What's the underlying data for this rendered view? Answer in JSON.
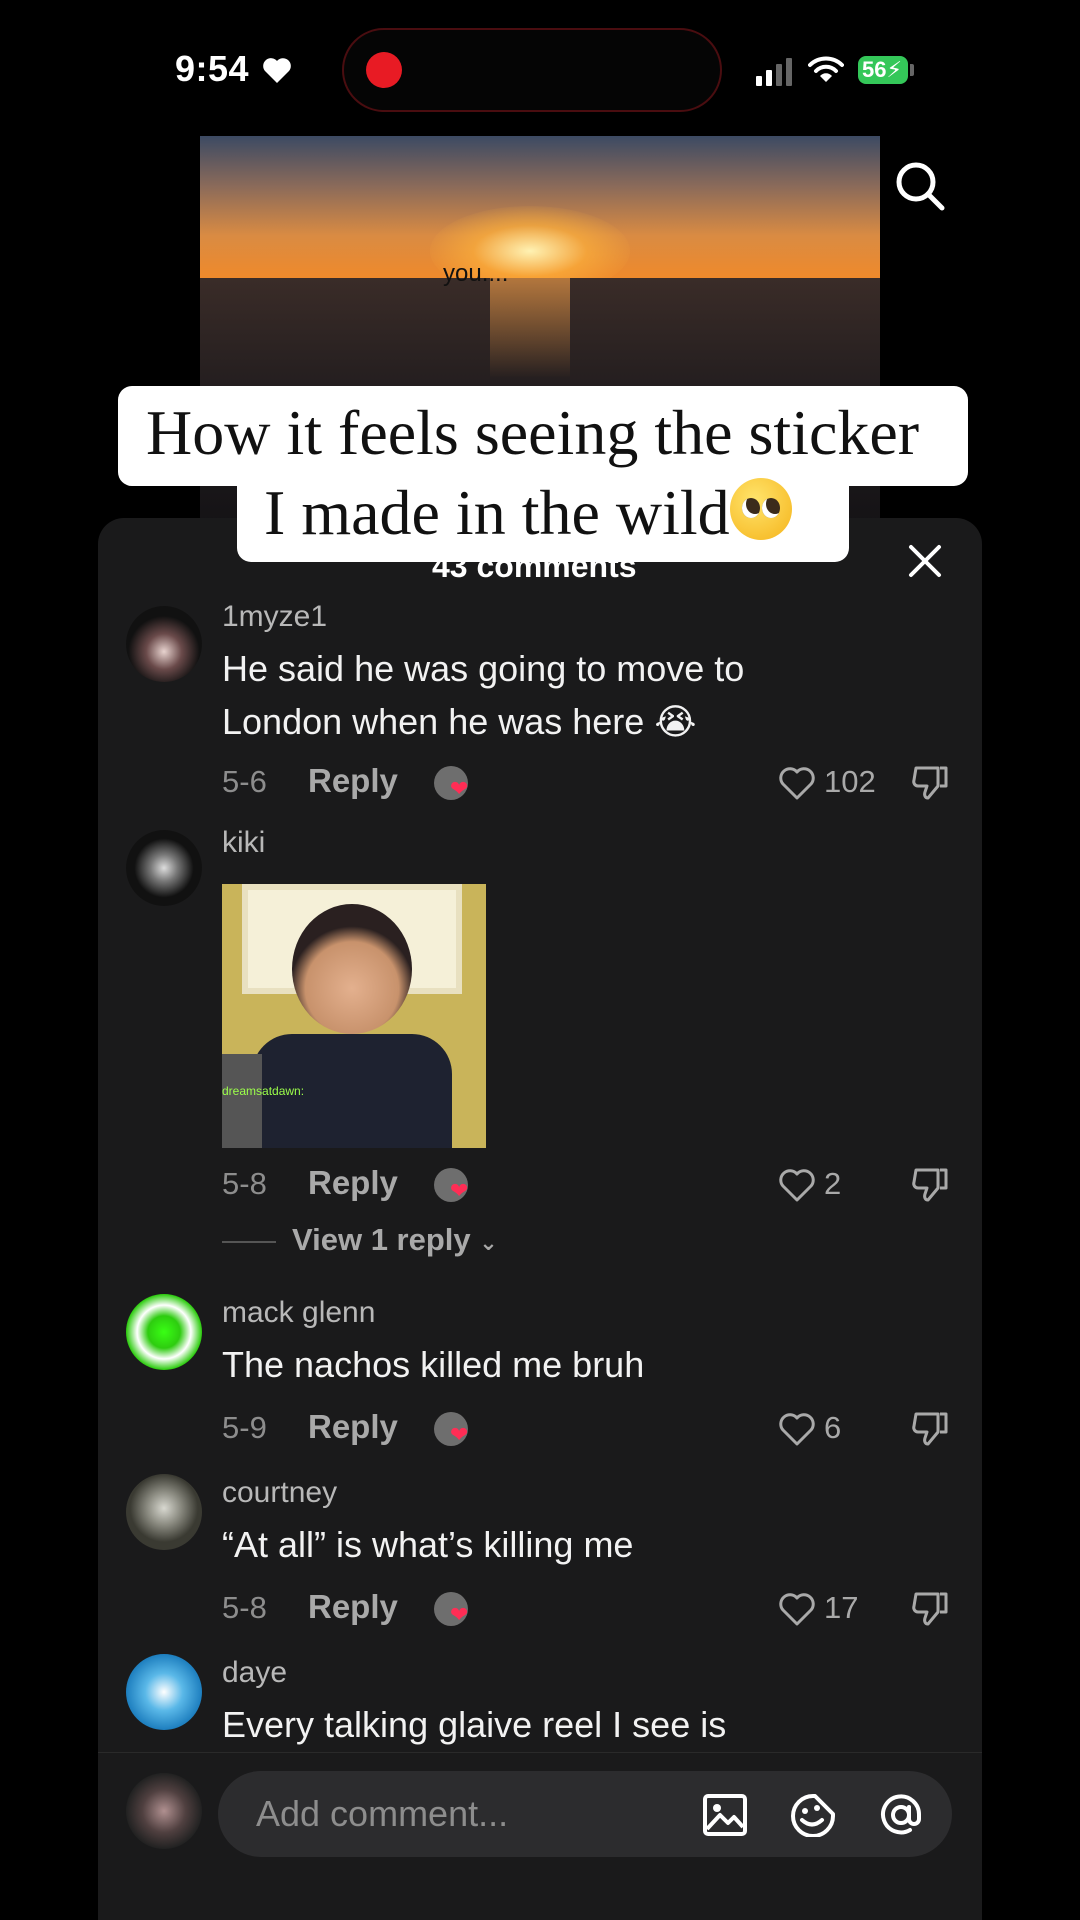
{
  "status_bar": {
    "time": "9:54",
    "battery": "56"
  },
  "video": {
    "caption": "you...."
  },
  "overlay": {
    "title_line1": "How it feels seeing the sticker",
    "title_line2": "I made in the wild"
  },
  "comments_sheet": {
    "count_label": "43 comments",
    "comments": [
      {
        "username": "1myze1",
        "text": "He said he was going to move to London when he was here 😭",
        "date": "5-6",
        "reply": "Reply",
        "likes": "102"
      },
      {
        "username": "kiki",
        "text": "",
        "date": "5-8",
        "reply": "Reply",
        "likes": "2",
        "sticker_caption": "dreamsatdawn:",
        "view_replies": "View 1 reply"
      },
      {
        "username": "mack glenn",
        "text": "The nachos killed me bruh",
        "date": "5-9",
        "reply": "Reply",
        "likes": "6"
      },
      {
        "username": "courtney",
        "text": "“At all” is what’s killing me",
        "date": "5-8",
        "reply": "Reply",
        "likes": "17"
      },
      {
        "username": "daye",
        "text": "Every talking glaive reel I see is"
      }
    ],
    "input": {
      "placeholder": "Add comment..."
    }
  },
  "colors": {
    "background": "#000000",
    "sheet": "#1a1a1b",
    "accent_red": "#e81b24",
    "battery_green": "#34c759",
    "heart_red": "#ff2d55"
  },
  "icons": [
    "heart-icon",
    "record-dot",
    "signal-icon",
    "wifi-icon",
    "battery-icon",
    "search-icon",
    "close-icon",
    "like-icon",
    "dislike-icon",
    "image-icon",
    "sticker-icon",
    "mention-icon"
  ]
}
